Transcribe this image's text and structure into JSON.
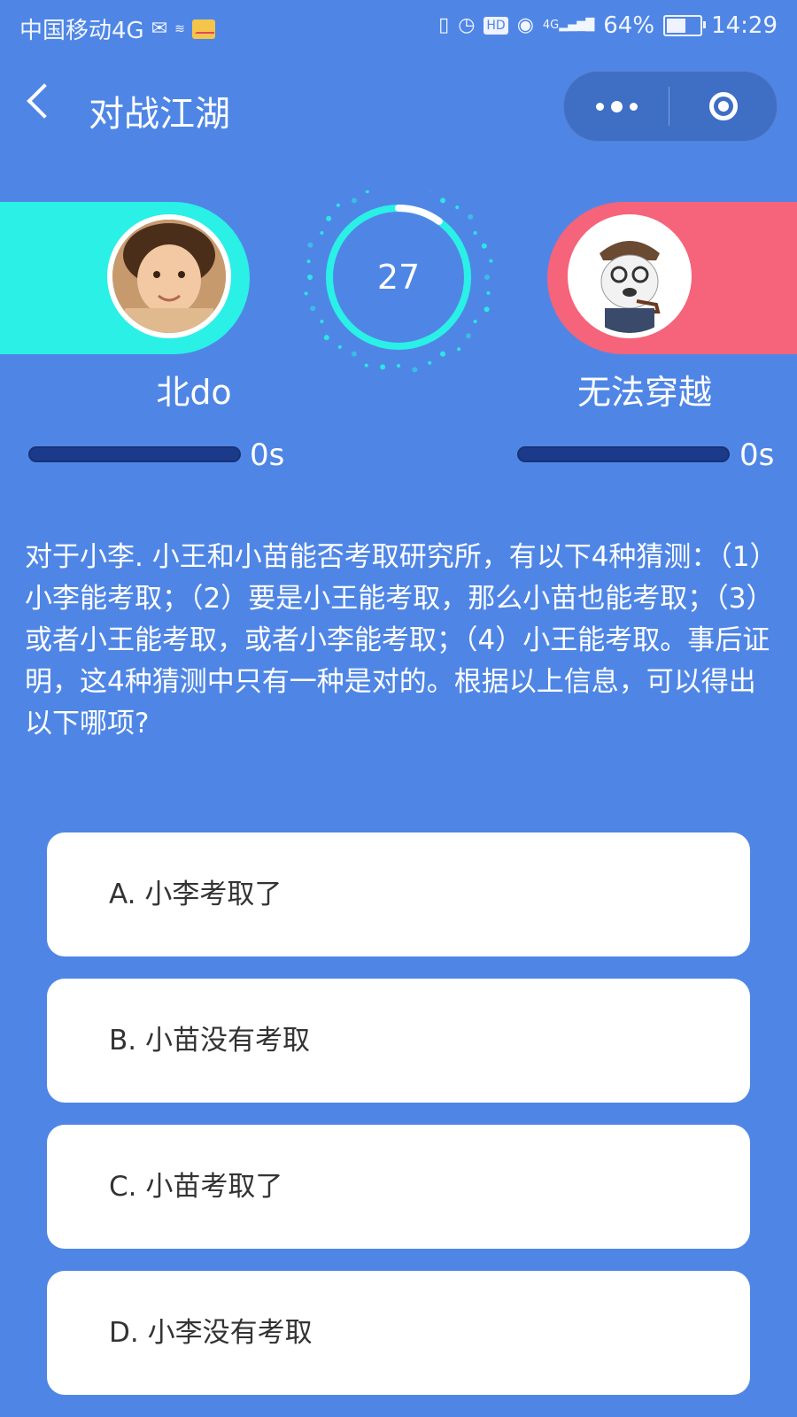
{
  "status_bar": {
    "carrier": "中国移动4G",
    "network": "4G",
    "battery": "64%",
    "battery_level": 0.64,
    "time": "14:29",
    "icons": [
      "wechat-icon",
      "speed-icon",
      "mail-icon",
      "vibrate-icon",
      "alarm-icon",
      "hd-icon",
      "eye-icon",
      "signal-icon",
      "battery-icon"
    ]
  },
  "nav": {
    "title": "对战江湖",
    "back_icon": "chevron-left-icon",
    "more_icon": "more-dots-icon",
    "close_icon": "target-icon"
  },
  "players": {
    "left": {
      "name": "北do",
      "time": "0s",
      "progress": 0,
      "color": "#2af0e6"
    },
    "right": {
      "name": "无法穿越",
      "time": "0s",
      "progress": 0,
      "color": "#f5647a"
    }
  },
  "timer": {
    "value": "27",
    "remaining_fraction": 0.9
  },
  "question": {
    "text": "对于小李. 小王和小苗能否考取研究所，有以下4种猜测：（1）小李能考取；（2）要是小王能考取，那么小苗也能考取；（3）或者小王能考取，或者小李能考取；（4）小王能考取。事后证明，这4种猜测中只有一种是对的。根据以上信息，可以得出以下哪项?"
  },
  "options": [
    {
      "label": "A. 小李考取了"
    },
    {
      "label": "B. 小苗没有考取"
    },
    {
      "label": "C. 小苗考取了"
    },
    {
      "label": "D. 小李没有考取"
    }
  ],
  "colors": {
    "background": "#4f86e6",
    "accent": "#2af0e6",
    "opponent": "#f5647a"
  }
}
